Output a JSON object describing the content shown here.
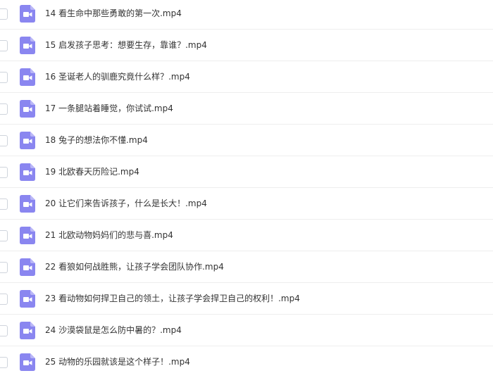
{
  "colors": {
    "video_icon": "#8a86f0",
    "video_icon_fold": "#b9b6f7",
    "row_divider": "#eeeeee",
    "text": "#333333"
  },
  "icons": {
    "row_checkbox": "checkbox",
    "file_icon": "video-file-icon"
  },
  "files": [
    {
      "name": "14 看生命中那些勇敢的第一次.mp4"
    },
    {
      "name": "15 启发孩子思考：想要生存，靠谁？.mp4"
    },
    {
      "name": "16 圣诞老人的驯鹿究竟什么样？.mp4"
    },
    {
      "name": "17 一条腿站着睡觉，你试试.mp4"
    },
    {
      "name": "18 兔子的想法你不懂.mp4"
    },
    {
      "name": "19 北欧春天历险记.mp4"
    },
    {
      "name": "20 让它们来告诉孩子，什么是长大！.mp4"
    },
    {
      "name": "21 北欧动物妈妈们的悲与喜.mp4"
    },
    {
      "name": "22 看狼如何战胜熊，让孩子学会团队协作.mp4"
    },
    {
      "name": "23 看动物如何捍卫自己的领土，让孩子学会捍卫自己的权利！.mp4"
    },
    {
      "name": "24 沙漠袋鼠是怎么防中暑的？.mp4"
    },
    {
      "name": "25 动物的乐园就该是这个样子！.mp4"
    }
  ]
}
